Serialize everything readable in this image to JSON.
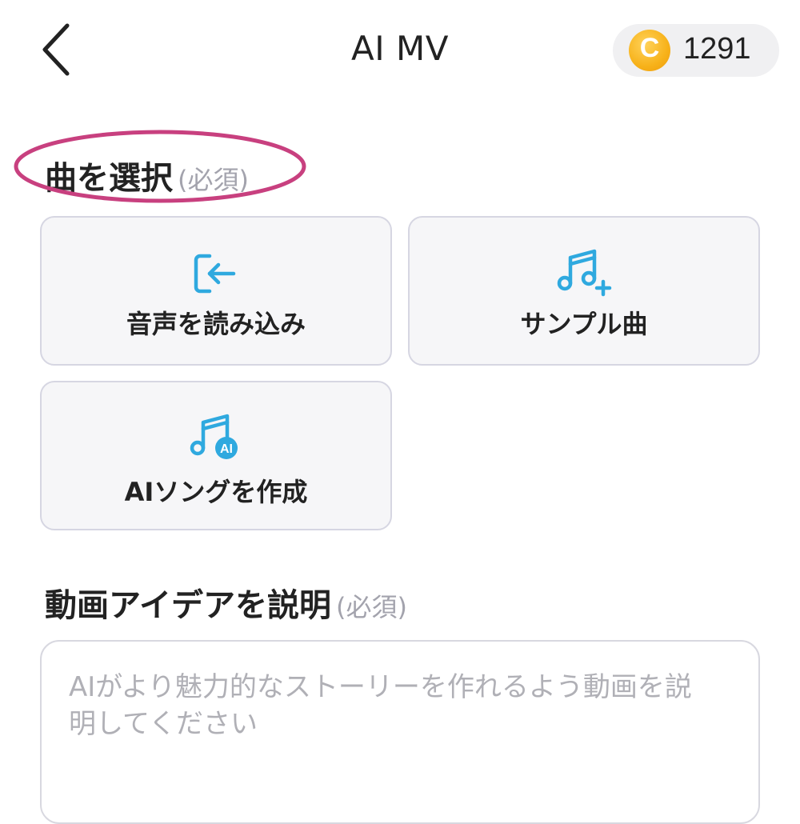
{
  "header": {
    "title": "AI MV",
    "coins": {
      "icon_letter": "C",
      "count": "1291"
    }
  },
  "song_section": {
    "title": "曲を選択",
    "required": "(必須)",
    "options": [
      {
        "label": "音声を読み込み",
        "icon": "import-audio-icon"
      },
      {
        "label": "サンプル曲",
        "icon": "music-note-plus-icon"
      },
      {
        "label": "AIソングを作成",
        "icon": "music-note-ai-icon",
        "badge": "AI"
      }
    ]
  },
  "idea_section": {
    "title": "動画アイデアを説明",
    "required": "(必須)",
    "placeholder": "AIがより魅力的なストーリーを作れるよう動画を説明してください"
  },
  "colors": {
    "accent_icon": "#2fa9df",
    "highlight": "#c8407f",
    "card_bg": "#f6f6f8",
    "card_border": "#d6d6e2",
    "coin": "#f7b21a"
  }
}
